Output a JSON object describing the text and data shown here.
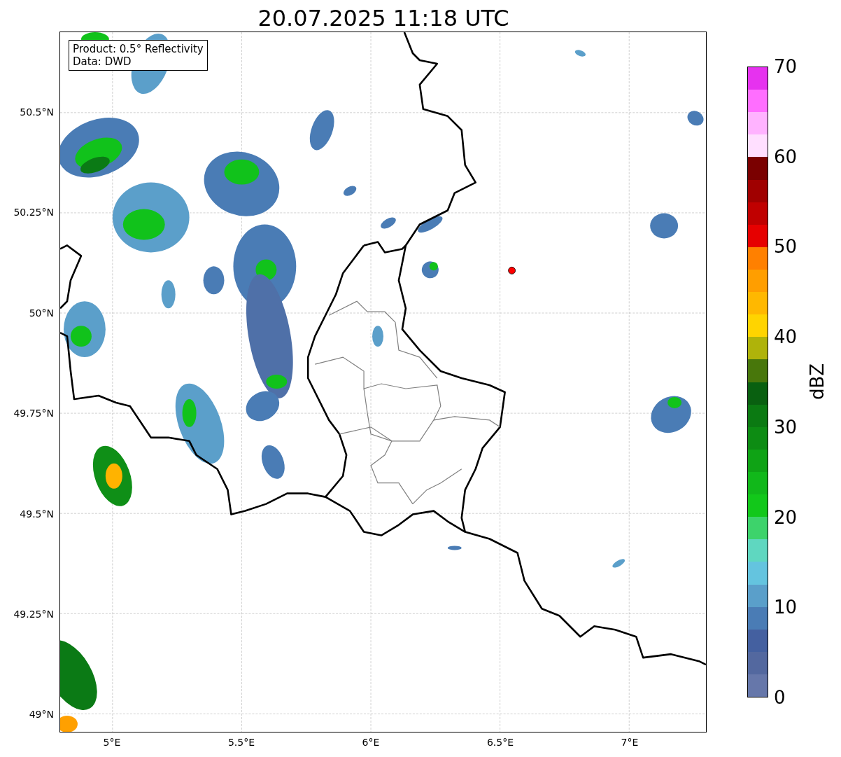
{
  "title": "20.07.2025 11:18 UTC",
  "legend": {
    "lines": [
      "Product: 0.5° Reflectivity",
      "Data: DWD"
    ]
  },
  "map": {
    "yticks": [
      "50.5°N",
      "50.25°N",
      "50°N",
      "49.75°N",
      "49.5°N",
      "49.25°N",
      "49°N"
    ],
    "xticks": [
      "5°E",
      "5.5°E",
      "6°E",
      "6.5°E",
      "7°E"
    ]
  },
  "colorbar": {
    "label": "dBZ",
    "ticks": [
      "70",
      "60",
      "50",
      "40",
      "30",
      "20",
      "10",
      "0"
    ],
    "bands": [
      {
        "color": "#e632ef"
      },
      {
        "color": "#ff6eff"
      },
      {
        "color": "#ffb3ff"
      },
      {
        "color": "#ffdfff"
      },
      {
        "color": "#7a0000"
      },
      {
        "color": "#a00000"
      },
      {
        "color": "#c00000"
      },
      {
        "color": "#e60000"
      },
      {
        "color": "#ff8000"
      },
      {
        "color": "#ff9e00"
      },
      {
        "color": "#ffb800"
      },
      {
        "color": "#ffd400"
      },
      {
        "color": "#afb30a"
      },
      {
        "color": "#48770b"
      },
      {
        "color": "#096010"
      },
      {
        "color": "#0b7a12"
      },
      {
        "color": "#0d8c13"
      },
      {
        "color": "#0fa315"
      },
      {
        "color": "#11b81a"
      },
      {
        "color": "#12c81a"
      },
      {
        "color": "#3dd36b"
      },
      {
        "color": "#5fd7c0"
      },
      {
        "color": "#64c4df"
      },
      {
        "color": "#5a9fca"
      },
      {
        "color": "#4a7cb5"
      },
      {
        "color": "#4460a0"
      },
      {
        "color": "#53689f"
      },
      {
        "color": "#6677aa"
      }
    ]
  }
}
